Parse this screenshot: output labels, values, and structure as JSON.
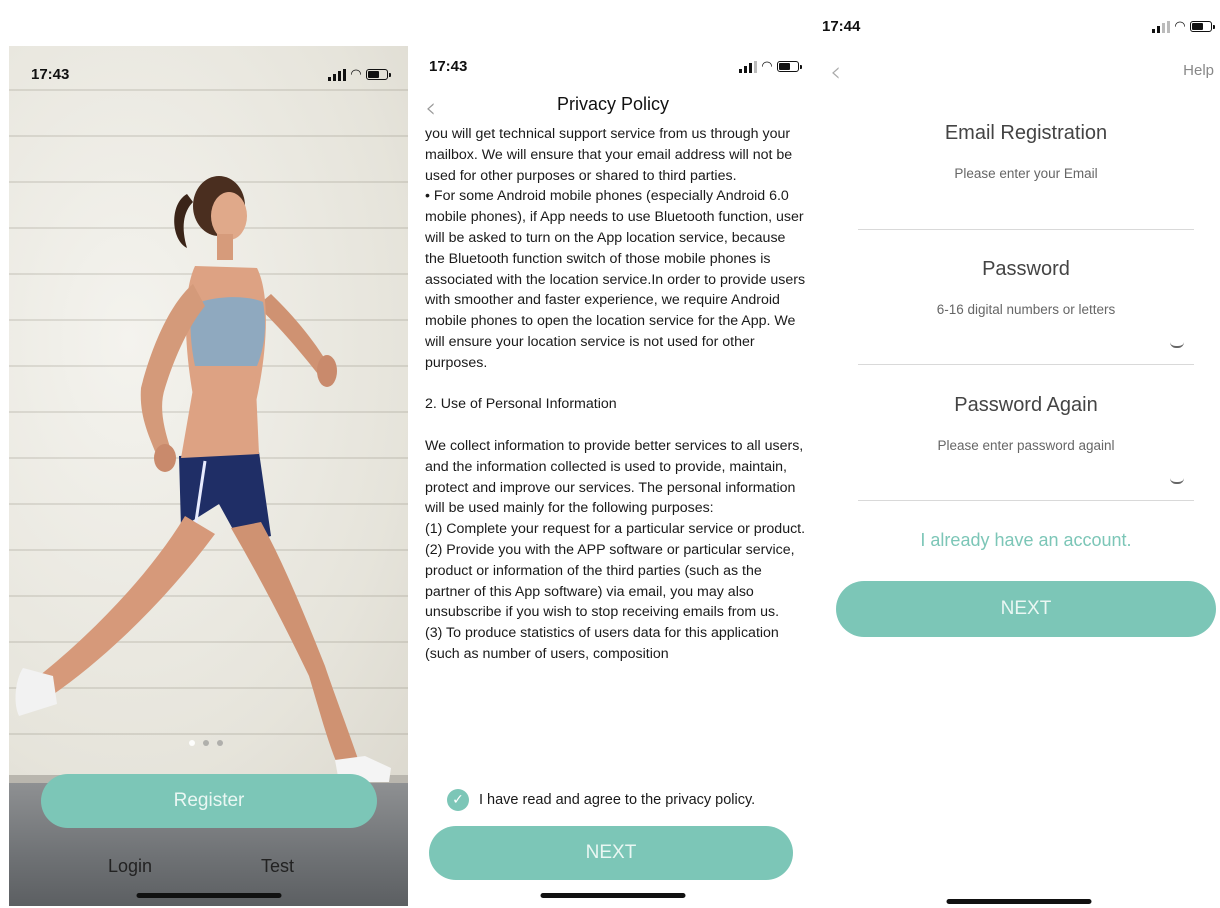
{
  "screen1": {
    "time": "17:43",
    "register_label": "Register",
    "login_label": "Login",
    "test_label": "Test"
  },
  "screen2": {
    "time": "17:43",
    "title": "Privacy Policy",
    "policy_paragraphs": [
      "you will get technical support service from us through your mailbox. We will ensure that your email address will not be used for other purposes or shared to third parties.",
      "• For some Android mobile phones (especially Android 6.0 mobile phones), if App needs to use Bluetooth function, user will be asked to turn on the App location service, because the Bluetooth function switch of those mobile phones is associated with the location service.In order to provide users with smoother and faster experience, we require Android mobile phones to open the location service for the App. We will ensure your location service is not used for other purposes.",
      "",
      "2. Use of Personal Information",
      "",
      "We collect information to provide better services to all users, and the information collected is used to provide, maintain, protect and improve our services. The personal information will be used mainly for the following purposes:",
      "(1) Complete your request for a particular service or product.",
      "(2) Provide you with the APP software or particular service, product or information of the third parties (such as the partner of this App software) via email, you may also unsubscribe if you wish to stop receiving emails from us.",
      "(3) To produce statistics of users data for this application (such as number of users, composition"
    ],
    "agree_label": "I have read and agree to the privacy policy.",
    "next_label": "NEXT"
  },
  "screen3": {
    "time": "17:44",
    "help_label": "Help",
    "email_title": "Email Registration",
    "email_hint": "Please enter your Email",
    "password_title": "Password",
    "password_hint": "6-16 digital numbers or letters",
    "password_again_title": "Password Again",
    "password_again_hint": "Please enter password againl",
    "account_link": "I already have an account.",
    "next_label": "NEXT"
  },
  "colors": {
    "accent": "#7cc6b7",
    "button_text": "#eaf7f3"
  }
}
